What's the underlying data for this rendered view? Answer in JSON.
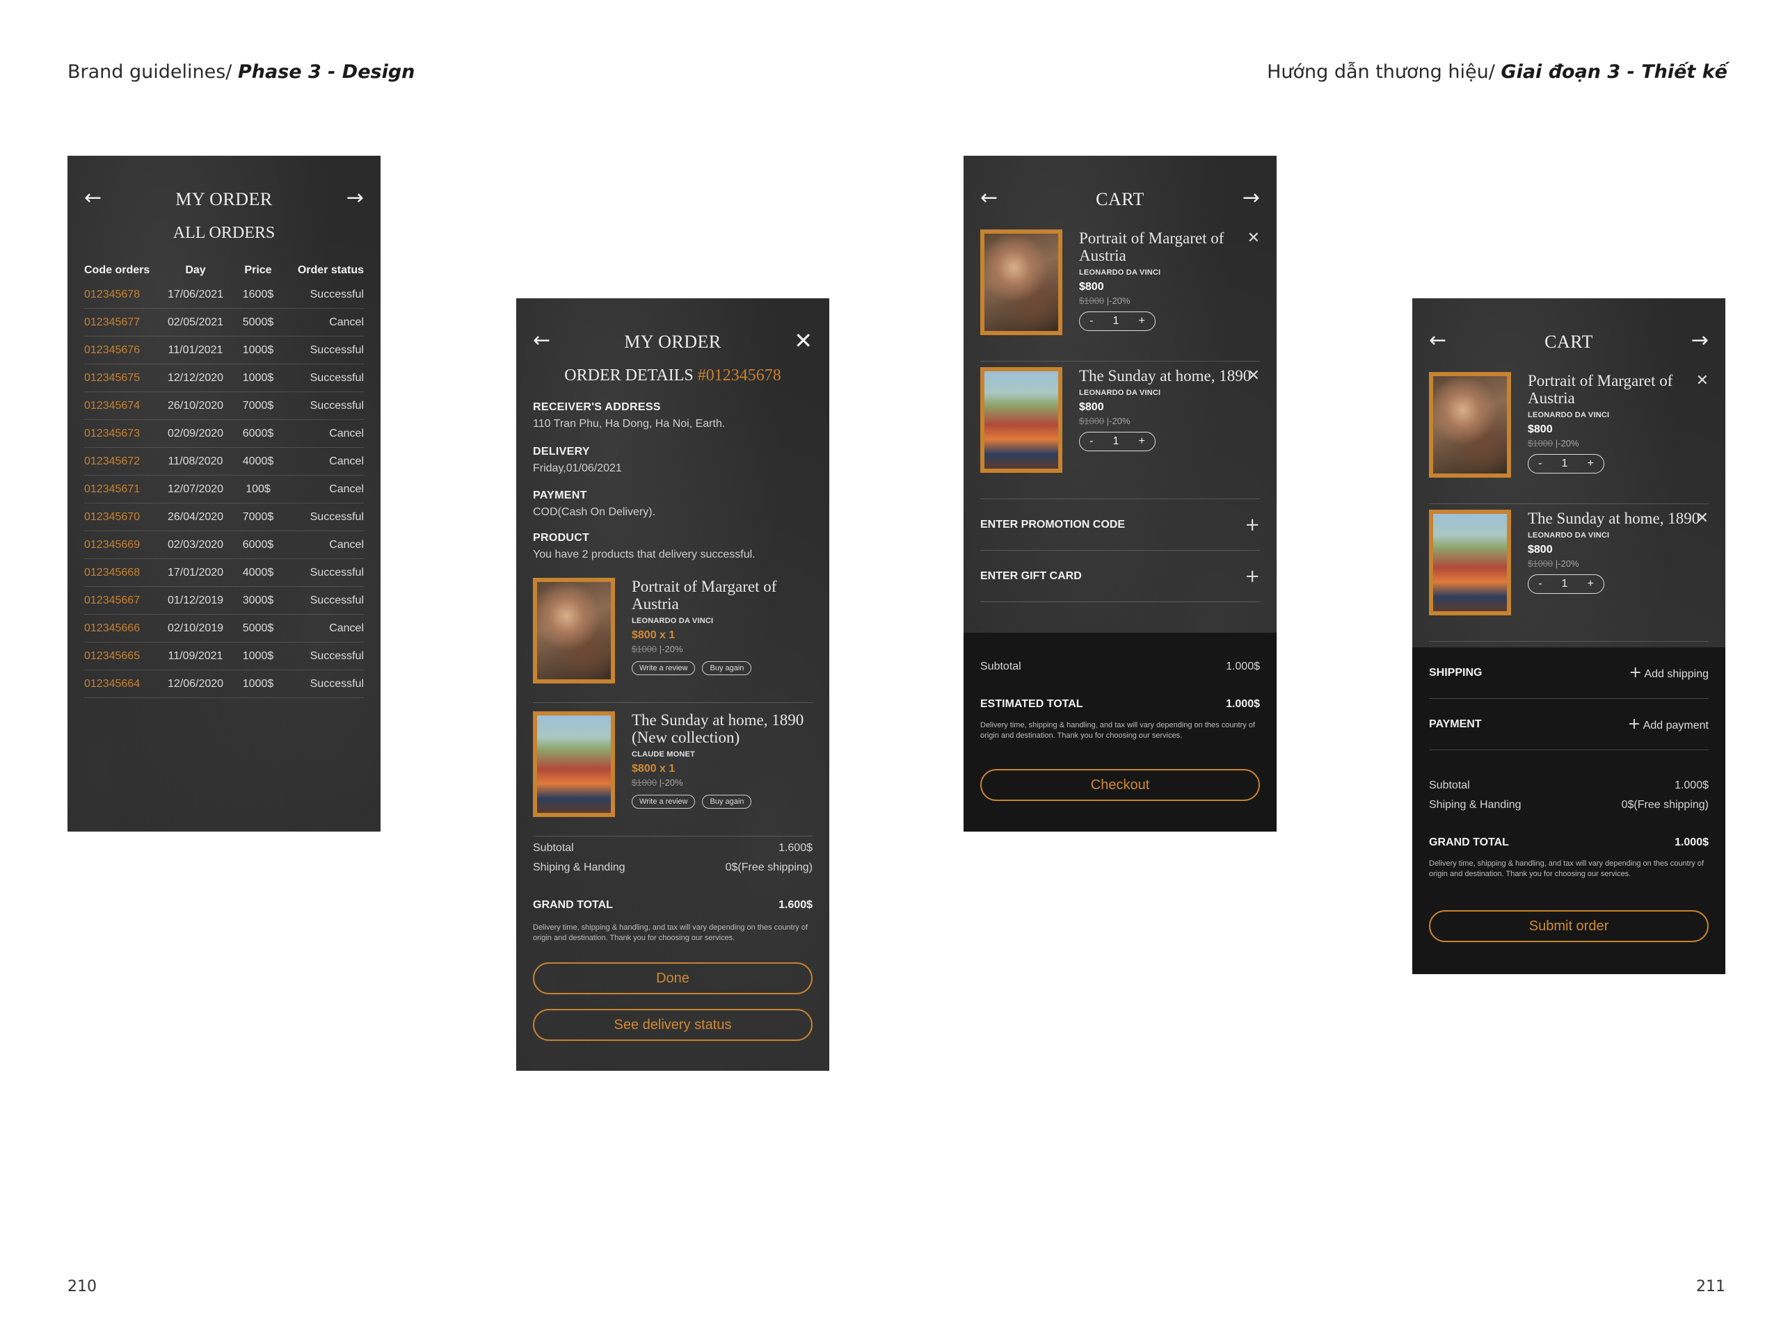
{
  "header": {
    "left_prefix": "Brand guidelines/ ",
    "left_bold": "Phase 3 - Design",
    "right_prefix": "Hướng dẫn thương hiệu/ ",
    "right_bold": "Giai đoạn 3 - Thiết kế"
  },
  "page_numbers": {
    "left": "210",
    "right": "211"
  },
  "icons": {
    "back": "arrow-left-icon",
    "forward": "arrow-right-icon",
    "close": "close-icon",
    "plus": "plus-icon"
  },
  "colors": {
    "accent": "#c8812f",
    "background": "#2b2b2b",
    "summary_bg": "#161616"
  },
  "my_order": {
    "title": "MY ORDER",
    "subtitle": "ALL ORDERS",
    "columns": [
      "Code orders",
      "Day",
      "Price",
      "Order status"
    ],
    "rows": [
      [
        "012345678",
        "17/06/2021",
        "1600$",
        "Successful"
      ],
      [
        "012345677",
        "02/05/2021",
        "5000$",
        "Cancel"
      ],
      [
        "012345676",
        "11/01/2021",
        "1000$",
        "Successful"
      ],
      [
        "012345675",
        "12/12/2020",
        "1000$",
        "Successful"
      ],
      [
        "012345674",
        "26/10/2020",
        "7000$",
        "Successful"
      ],
      [
        "012345673",
        "02/09/2020",
        "6000$",
        "Cancel"
      ],
      [
        "012345672",
        "11/08/2020",
        "4000$",
        "Cancel"
      ],
      [
        "012345671",
        "12/07/2020",
        "100$",
        "Cancel"
      ],
      [
        "012345670",
        "26/04/2020",
        "7000$",
        "Successful"
      ],
      [
        "012345669",
        "02/03/2020",
        "6000$",
        "Cancel"
      ],
      [
        "012345668",
        "17/01/2020",
        "4000$",
        "Successful"
      ],
      [
        "012345667",
        "01/12/2019",
        "3000$",
        "Successful"
      ],
      [
        "012345666",
        "02/10/2019",
        "5000$",
        "Cancel"
      ],
      [
        "012345665",
        "11/09/2021",
        "1000$",
        "Successful"
      ],
      [
        "012345664",
        "12/06/2020",
        "1000$",
        "Successful"
      ]
    ]
  },
  "order_details": {
    "title": "MY ORDER",
    "subtitle": "ORDER DETAILS",
    "order_code": "#012345678",
    "receiver_label": "RECEIVER'S ADDRESS",
    "receiver_value": "110 Tran Phu, Ha Dong, Ha Noi, Earth.",
    "delivery_label": "DELIVERY",
    "delivery_value": "Friday,01/06/2021",
    "payment_label": "PAYMENT",
    "payment_value": "COD(Cash On Delivery).",
    "product_label": "PRODUCT",
    "product_value": "You have 2 products that delivery successful.",
    "products": [
      {
        "name": "Portrait of Margaret of Austria",
        "artist": "LEONARDO DA VINCI",
        "price": "$800 x 1",
        "old_price": "$1000",
        "discount": "|-20%",
        "review": "Write a review",
        "again": "Buy again"
      },
      {
        "name": "The Sunday at home, 1890 (New collection)",
        "artist": "CLAUDE MONET",
        "price": "$800 x 1",
        "old_price": "$1000",
        "discount": "|-20%",
        "review": "Write a review",
        "again": "Buy again"
      }
    ],
    "subtotal_label": "Subtotal",
    "subtotal_value": "1.600$",
    "shipping_label": "Shiping & Handing",
    "shipping_value": "0$(Free shipping)",
    "grand_label": "GRAND TOTAL",
    "grand_value": "1.600$",
    "note": "Delivery time, shipping & handling, and tax will vary depending on thes country of origin and destination. Thank you for choosing our services.",
    "done": "Done",
    "status": "See delivery status"
  },
  "cart1": {
    "title": "CART",
    "items": [
      {
        "name": "Portrait of Margaret of Austria",
        "artist": "LEONARDO DA VINCI",
        "price": "$800",
        "old_price": "$1000",
        "discount": "|-20%",
        "minus": "-",
        "qty": "1",
        "plus": "+"
      },
      {
        "name": "The Sunday at home, 1890",
        "artist": "LEONARDO DA VINCI",
        "price": "$800",
        "old_price": "$1000",
        "discount": "|-20%",
        "minus": "-",
        "qty": "1",
        "plus": "+"
      }
    ],
    "promo": "ENTER PROMOTION CODE",
    "gift": "ENTER GIFT CARD",
    "subtotal_label": "Subtotal",
    "subtotal_value": "1.000$",
    "estimated_label": "ESTIMATED TOTAL",
    "estimated_value": "1.000$",
    "note": "Delivery time, shipping & handling, and tax will vary depending on thes country of origin and destination. Thank you for choosing our services.",
    "checkout": "Checkout"
  },
  "cart2": {
    "title": "CART",
    "items": [
      {
        "name": "Portrait of Margaret of Austria",
        "artist": "LEONARDO DA VINCI",
        "price": "$800",
        "old_price": "$1000",
        "discount": "|-20%",
        "minus": "-",
        "qty": "1",
        "plus": "+"
      },
      {
        "name": "The Sunday at home, 1890",
        "artist": "LEONARDO DA VINCI",
        "price": "$800",
        "old_price": "$1000",
        "discount": "|-20%",
        "minus": "-",
        "qty": "1",
        "plus": "+"
      }
    ],
    "shipping_label": "SHIPPING",
    "shipping_action": "Add shipping",
    "payment_label": "PAYMENT",
    "payment_action": "Add payment",
    "subtotal_label": "Subtotal",
    "subtotal_value": "1.000$",
    "ship_label": "Shiping & Handing",
    "ship_value": "0$(Free shipping)",
    "grand_label": "GRAND TOTAL",
    "grand_value": "1.000$",
    "note": "Delivery time, shipping & handling, and tax will vary depending on thes country of origin and destination. Thank you for choosing our services.",
    "submit": "Submit order"
  }
}
